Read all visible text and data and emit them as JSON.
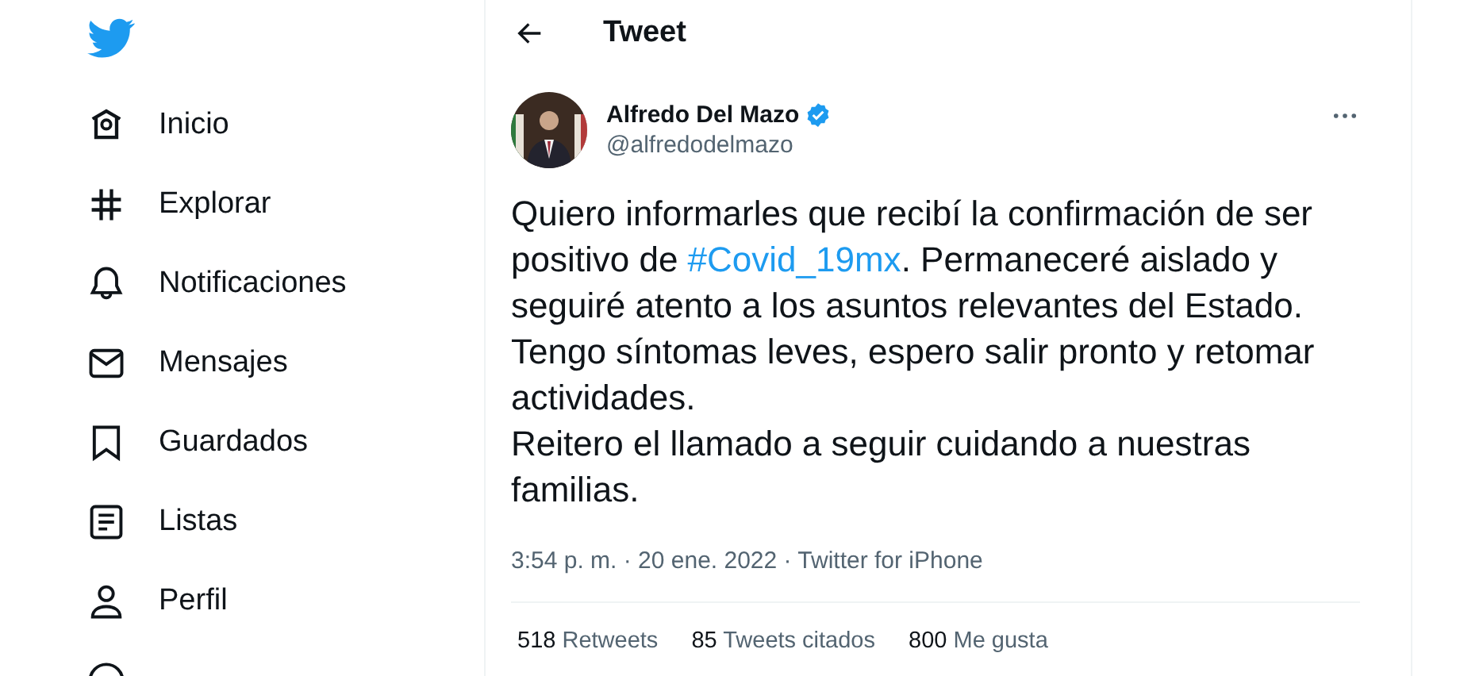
{
  "sidebar": {
    "items": [
      {
        "label": "Inicio",
        "kind": "home"
      },
      {
        "label": "Explorar",
        "kind": "hash"
      },
      {
        "label": "Notificaciones",
        "kind": "bell"
      },
      {
        "label": "Mensajes",
        "kind": "mail"
      },
      {
        "label": "Guardados",
        "kind": "bookmark"
      },
      {
        "label": "Listas",
        "kind": "list"
      },
      {
        "label": "Perfil",
        "kind": "person"
      },
      {
        "kind": "more"
      }
    ]
  },
  "header": {
    "title": "Tweet"
  },
  "tweet": {
    "name": "Alfredo Del Mazo",
    "verified": true,
    "handle": "@alfredodelmazo",
    "text": [
      {
        "kind": "text",
        "text": "Quiero informarles que recibí la confirmación de ser positivo de "
      },
      {
        "kind": "hashtag",
        "text": "#Covid_19mx"
      },
      {
        "kind": "text",
        "text": ". Permaneceré aislado y seguiré atento a los asuntos relevantes del Estado.\nTengo síntomas leves, espero salir pronto y retomar actividades.\nReitero el llamado a seguir cuidando a nuestras familias."
      }
    ],
    "meta": "3:54 p. m. · 20 ene. 2022 · Twitter for iPhone",
    "stats": [
      {
        "count": "518",
        "label": "Retweets"
      },
      {
        "count": "85",
        "label": "Tweets citados"
      },
      {
        "count": "800",
        "label": "Me gusta"
      }
    ]
  }
}
